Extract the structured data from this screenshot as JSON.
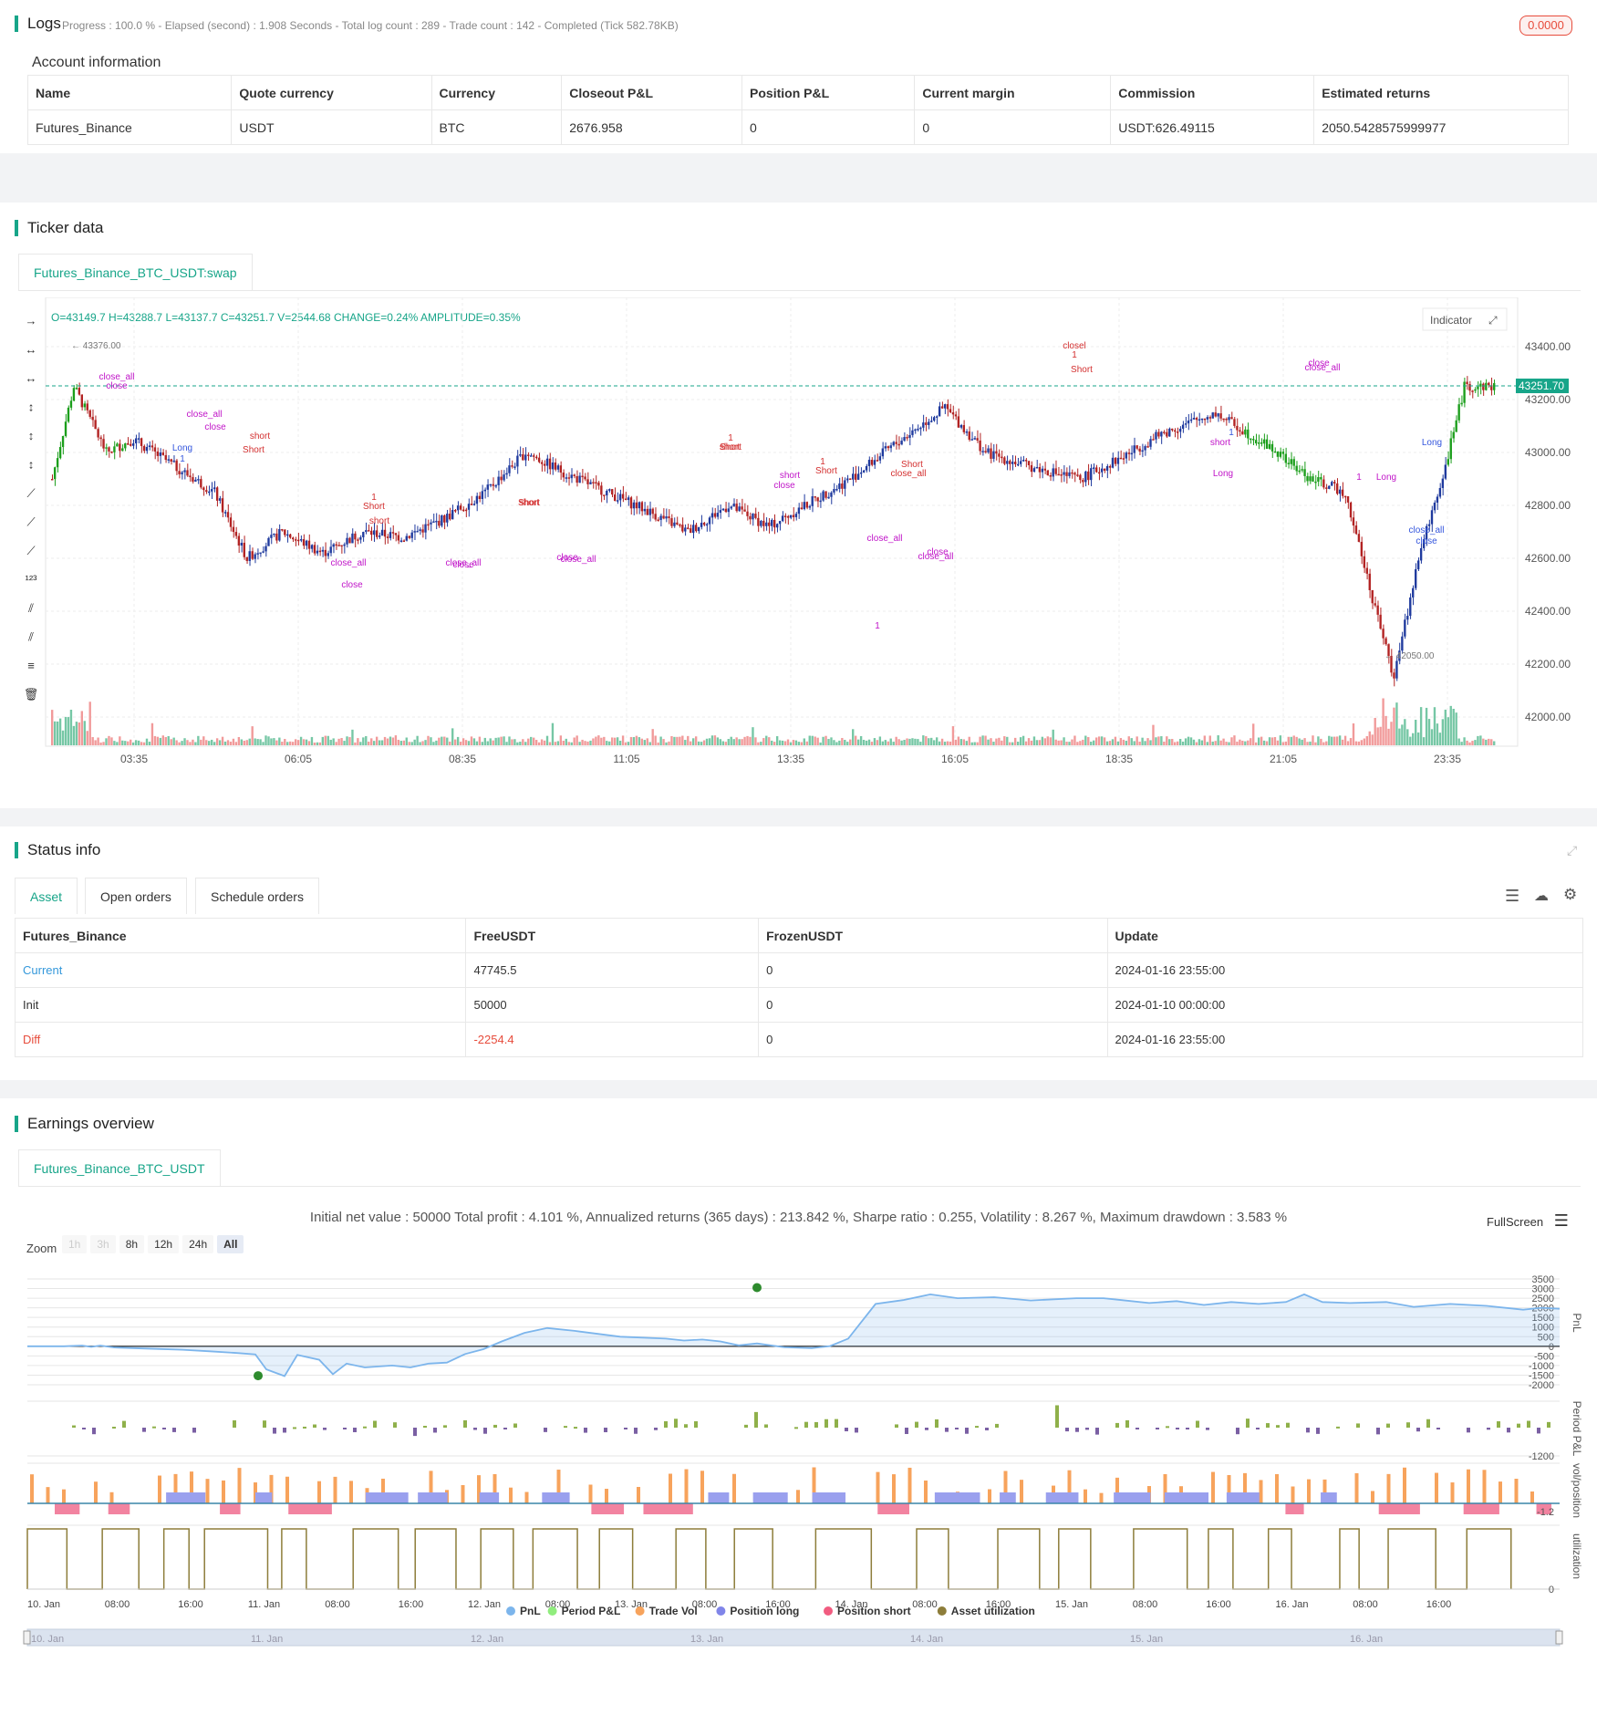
{
  "logs": {
    "title": "Logs",
    "status": "Progress : 100.0 % - Elapsed (second) : 1.908  Seconds - Total log count : 289 - Trade count : 142 - Completed (Tick 582.78KB)",
    "badge": "0.0000"
  },
  "account": {
    "title": "Account information",
    "headers": [
      "Name",
      "Quote currency",
      "Currency",
      "Closeout P&L",
      "Position P&L",
      "Current margin",
      "Commission",
      "Estimated returns"
    ],
    "row": [
      "Futures_Binance",
      "USDT",
      "BTC",
      "2676.958",
      "0",
      "0",
      "USDT:626.49115",
      "2050.5428575999977"
    ]
  },
  "ticker": {
    "title": "Ticker data",
    "tab": "Futures_Binance_BTC_USDT:swap",
    "ohlc": "O=43149.7 H=43288.7 L=43137.7 C=43251.7 V=2544.68 CHANGE=0.24% AMPLITUDE=0.35%",
    "indicator_button": "Indicator",
    "last_price": "43251.70",
    "high_marker": "43376.00",
    "low_marker": "42050.00",
    "y_ticks": [
      "43400.00",
      "43200.00",
      "43000.00",
      "42800.00",
      "42600.00",
      "42400.00",
      "42200.00",
      "42000.00"
    ],
    "x_ticks": [
      "03:35",
      "06:05",
      "08:35",
      "11:05",
      "13:35",
      "16:05",
      "18:35",
      "21:05",
      "23:35"
    ],
    "annotations": [
      "close_all",
      "close",
      "close_all",
      "close",
      "Long",
      "1",
      "short",
      "Short",
      "1",
      "Short",
      "short",
      "close_all",
      "close",
      "Short",
      "short",
      "close_all",
      "close",
      "close_all",
      "close",
      "1",
      "Short",
      "short",
      "1",
      "Short",
      "short",
      "close",
      "close_all",
      "Short",
      "1",
      "close_all",
      "close",
      "close_all",
      "closel",
      "1",
      "Short",
      "1",
      "short",
      "Long",
      "close_all",
      "close",
      "close_all",
      "close",
      "Long",
      "1",
      "Long"
    ]
  },
  "status": {
    "title": "Status info",
    "tabs": [
      "Asset",
      "Open orders",
      "Schedule orders"
    ],
    "headers": [
      "Futures_Binance",
      "FreeUSDT",
      "FrozenUSDT",
      "Update"
    ],
    "rows": [
      [
        "Current",
        "47745.5",
        "0",
        "2024-01-16 23:55:00"
      ],
      [
        "Init",
        "50000",
        "0",
        "2024-01-10 00:00:00"
      ],
      [
        "Diff",
        "-2254.4",
        "0",
        "2024-01-16 23:55:00"
      ]
    ]
  },
  "earnings": {
    "title": "Earnings overview",
    "tab": "Futures_Binance_BTC_USDT",
    "summary": "Initial net value : 50000 Total profit : 4.101 %, Annualized returns (365 days) : 213.842 %, Sharpe ratio : 0.255, Volatility : 8.267 %, Maximum drawdown : 3.583 %",
    "fullscreen": "FullScreen",
    "zoom_label": "Zoom",
    "zoom_options": [
      "1h",
      "3h",
      "8h",
      "12h",
      "24h",
      "All"
    ],
    "pnl_ticks": [
      "3500",
      "3000",
      "2500",
      "2000",
      "1500",
      "1000",
      "500",
      "0",
      "-500",
      "-1000",
      "-1500",
      "-2000"
    ],
    "period_tick": "-1200",
    "vol_tick": "-1.2",
    "util_tick": "0",
    "axis_labels": [
      "PnL",
      "Period P&L",
      "vol/position",
      "utilization"
    ],
    "x_ticks": [
      "10. Jan",
      "08:00",
      "16:00",
      "11. Jan",
      "08:00",
      "16:00",
      "12. Jan",
      "08:00",
      "13. Jan",
      "08:00",
      "16:00",
      "14. Jan",
      "08:00",
      "16:00",
      "15. Jan",
      "08:00",
      "16:00",
      "16. Jan",
      "08:00",
      "16:00"
    ],
    "navigator_ticks": [
      "10. Jan",
      "11. Jan",
      "12. Jan",
      "13. Jan",
      "14. Jan",
      "15. Jan",
      "16. Jan"
    ],
    "legend": [
      {
        "label": "PnL",
        "color": "#7cb5ec"
      },
      {
        "label": "Period P&L",
        "color": "#90ed7d"
      },
      {
        "label": "Trade Vol",
        "color": "#f7a35c"
      },
      {
        "label": "Position long",
        "color": "#8085e9"
      },
      {
        "label": "Position short",
        "color": "#f15c80"
      },
      {
        "label": "Asset utilization",
        "color": "#8d7d3a"
      }
    ]
  }
}
